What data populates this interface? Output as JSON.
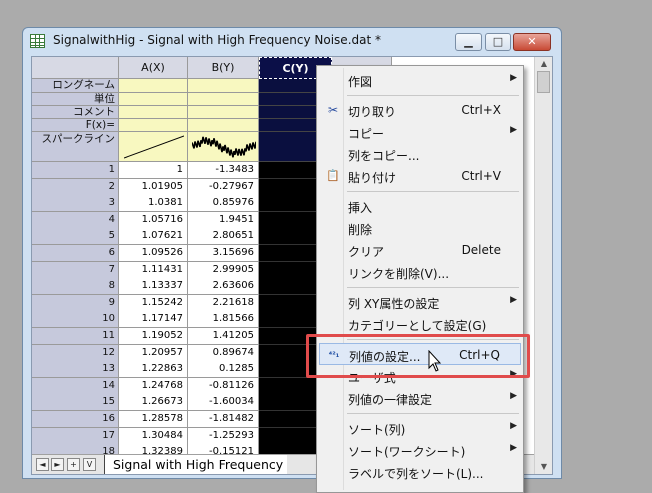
{
  "window": {
    "title": "SignalwithHig - Signal with High Frequency Noise.dat *",
    "minimize_glyph": "▁",
    "maximize_glyph": "□",
    "close_glyph": "✕"
  },
  "sheet": {
    "columns": [
      "A(X)",
      "B(Y)",
      "C(Y)"
    ],
    "row_labels": [
      "ロングネーム",
      "単位",
      "コメント",
      "F(x)=",
      "スパークライン"
    ],
    "rows": [
      [
        "1",
        "1",
        "-1.3483"
      ],
      [
        "2",
        "1.01905",
        "-0.27967"
      ],
      [
        "3",
        "1.0381",
        "0.85976"
      ],
      [
        "4",
        "1.05716",
        "1.9451"
      ],
      [
        "5",
        "1.07621",
        "2.80651"
      ],
      [
        "6",
        "1.09526",
        "3.15696"
      ],
      [
        "7",
        "1.11431",
        "2.99905"
      ],
      [
        "8",
        "1.13337",
        "2.63606"
      ],
      [
        "9",
        "1.15242",
        "2.21618"
      ],
      [
        "10",
        "1.17147",
        "1.81566"
      ],
      [
        "11",
        "1.19052",
        "1.41205"
      ],
      [
        "12",
        "1.20957",
        "0.89674"
      ],
      [
        "13",
        "1.22863",
        "0.1285"
      ],
      [
        "14",
        "1.24768",
        "-0.81126"
      ],
      [
        "15",
        "1.26673",
        "-1.60034"
      ],
      [
        "16",
        "1.28578",
        "-1.81482"
      ],
      [
        "17",
        "1.30484",
        "-1.25293"
      ],
      [
        "18",
        "1.32389",
        "-0.15121"
      ]
    ],
    "tab_nav": [
      "◄",
      "►",
      "+",
      "V"
    ],
    "tab_label": "Signal with High Frequency"
  },
  "context_menu": {
    "items": [
      {
        "label": "作図",
        "shortcut": "",
        "submenu": true,
        "icon": ""
      },
      {
        "label": "切り取り",
        "shortcut": "Ctrl+X",
        "submenu": false,
        "icon": "scissors-icon"
      },
      {
        "label": "コピー",
        "shortcut": "",
        "submenu": true,
        "icon": ""
      },
      {
        "label": "列をコピー...",
        "shortcut": "",
        "submenu": false,
        "icon": ""
      },
      {
        "label": "貼り付け",
        "shortcut": "Ctrl+V",
        "submenu": false,
        "icon": "paste-icon"
      },
      {
        "label": "挿入",
        "shortcut": "",
        "submenu": false,
        "icon": ""
      },
      {
        "label": "削除",
        "shortcut": "",
        "submenu": false,
        "icon": ""
      },
      {
        "label": "クリア",
        "shortcut": "Delete",
        "submenu": false,
        "icon": ""
      },
      {
        "label": "リンクを削除(V)...",
        "shortcut": "",
        "submenu": false,
        "icon": ""
      },
      {
        "label": "列 XY属性の設定",
        "shortcut": "",
        "submenu": true,
        "icon": ""
      },
      {
        "label": "カテゴリーとして設定(G)",
        "shortcut": "",
        "submenu": false,
        "icon": ""
      },
      {
        "label": "列値の設定...",
        "shortcut": "Ctrl+Q",
        "submenu": false,
        "icon": "set-column-values-icon"
      },
      {
        "label": "ユーザ式",
        "shortcut": "",
        "submenu": true,
        "icon": ""
      },
      {
        "label": "列値の一律設定",
        "shortcut": "",
        "submenu": true,
        "icon": ""
      },
      {
        "label": "ソート(列)",
        "shortcut": "",
        "submenu": true,
        "icon": ""
      },
      {
        "label": "ソート(ワークシート)",
        "shortcut": "",
        "submenu": true,
        "icon": ""
      },
      {
        "label": "ラベルで列をソート(L)...",
        "shortcut": "",
        "submenu": false,
        "icon": ""
      }
    ],
    "submenu_arrow": "▶",
    "scissors_glyph": "✂",
    "paste_glyph": "📋",
    "setvalues_glyph": "⁴²₁"
  },
  "colors": {
    "highlight": "#e04b4b",
    "selected_column": "#0b0f48",
    "metadata_row": "#f8f8c0"
  }
}
